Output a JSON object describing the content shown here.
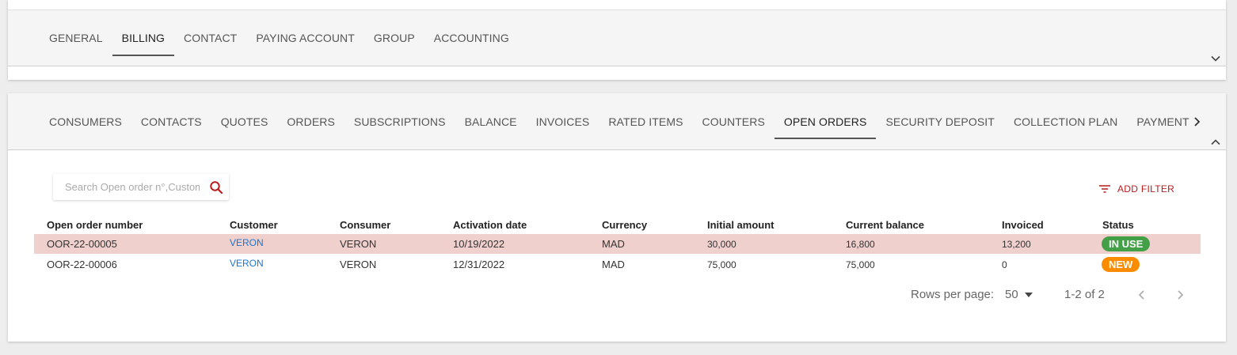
{
  "top_tabs": {
    "items": [
      "GENERAL",
      "BILLING",
      "CONTACT",
      "PAYING ACCOUNT",
      "GROUP",
      "ACCOUNTING"
    ],
    "active": "BILLING"
  },
  "sub_tabs": {
    "items": [
      "CONSUMERS",
      "CONTACTS",
      "QUOTES",
      "ORDERS",
      "SUBSCRIPTIONS",
      "BALANCE",
      "INVOICES",
      "RATED ITEMS",
      "COUNTERS",
      "OPEN ORDERS",
      "SECURITY DEPOSIT",
      "COLLECTION PLAN",
      "PAYMENT"
    ],
    "active": "OPEN ORDERS"
  },
  "search": {
    "placeholder": "Search Open order n°,Customer",
    "value": ""
  },
  "add_filter_label": "ADD FILTER",
  "table": {
    "columns": [
      "Open order number",
      "Customer",
      "Consumer",
      "Activation date",
      "Currency",
      "Initial amount",
      "Current balance",
      "Invoiced",
      "Status"
    ],
    "rows": [
      {
        "open_order_number": "OOR-22-00005",
        "customer": "VERON",
        "consumer": "VERON",
        "activation_date": "10/19/2022",
        "currency": "MAD",
        "initial_amount": "30,000",
        "current_balance": "16,800",
        "invoiced": "13,200",
        "status": "IN USE"
      },
      {
        "open_order_number": "OOR-22-00006",
        "customer": "VERON",
        "consumer": "VERON",
        "activation_date": "12/31/2022",
        "currency": "MAD",
        "initial_amount": "75,000",
        "current_balance": "75,000",
        "invoiced": "0",
        "status": "NEW"
      }
    ]
  },
  "pagination": {
    "rows_per_page_label": "Rows per page:",
    "rows_per_page_value": "50",
    "range_text": "1-2 of 2"
  },
  "colors": {
    "accent": "#b71c1c",
    "link": "#1976d2",
    "highlight_row": "#f0d0cd",
    "status_in_use": "#43a047",
    "status_new": "#fb8c00"
  },
  "icons": {
    "search": "search-icon",
    "filter": "filter-list-icon",
    "top_collapse": "chevron-down-icon",
    "sub_collapse": "chevron-up-icon",
    "tabs_scroll": "chevron-right-icon",
    "rows_dropdown": "caret-down-icon",
    "prev_page": "chevron-left-icon",
    "next_page": "chevron-right-icon"
  }
}
